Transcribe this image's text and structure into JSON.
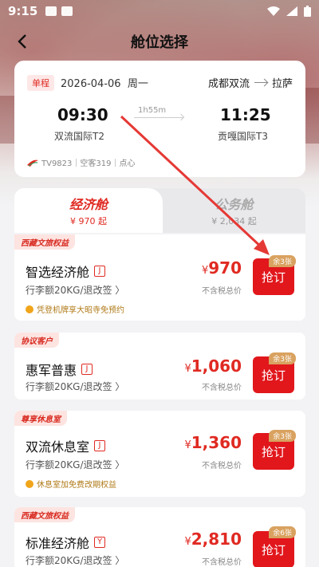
{
  "status_bar": {
    "time": "9:15"
  },
  "nav": {
    "title": "舱位选择"
  },
  "flight": {
    "trip_type": "单程",
    "date": "2026-04-06",
    "weekday": "周一",
    "origin": "成都双流",
    "destination": "拉萨",
    "dep_time": "09:30",
    "dep_airport": "双流国际T2",
    "arr_time": "11:25",
    "arr_airport": "贡嘎国际T3",
    "duration": "1h55m",
    "info": "TV9823｜空客319｜点心"
  },
  "tabs": {
    "economy": {
      "name": "经济舱",
      "price": "¥ 970 起"
    },
    "business": {
      "name": "公务舱",
      "price": "¥ 2,034 起"
    }
  },
  "fares": [
    {
      "tag": "西藏文旅权益",
      "name": "智选经济舱",
      "code": "J",
      "baggage": "行李额20KG/退改签 〉",
      "perk": "凭登机牌享大昭寺免预约",
      "currency": "¥",
      "price": "970",
      "note": "不含税总价",
      "remaining": "余3张",
      "button": "抢订"
    },
    {
      "tag": "协议客户",
      "name": "惠军普惠",
      "code": "J",
      "baggage": "行李额20KG/退改签 〉",
      "perk": "",
      "currency": "¥",
      "price": "1,060",
      "note": "不含税总价",
      "remaining": "余3张",
      "button": "抢订"
    },
    {
      "tag": "尊享休息室",
      "name": "双流休息室",
      "code": "J",
      "baggage": "行李额20KG/退改签 〉",
      "perk": "休息室加免费改期权益",
      "currency": "¥",
      "price": "1,360",
      "note": "不含税总价",
      "remaining": "余3张",
      "button": "抢订"
    },
    {
      "tag": "西藏文旅权益",
      "name": "标准经济舱",
      "code": "Y",
      "baggage": "行李额20KG/退改签 〉",
      "perk": "",
      "currency": "¥",
      "price": "2,810",
      "note": "不含税总价",
      "remaining": "余6张",
      "button": "抢订"
    }
  ],
  "colors": {
    "accent": "#e1171c",
    "remain_badge": "#d9a260",
    "annotation_arrow": "#e53935"
  }
}
